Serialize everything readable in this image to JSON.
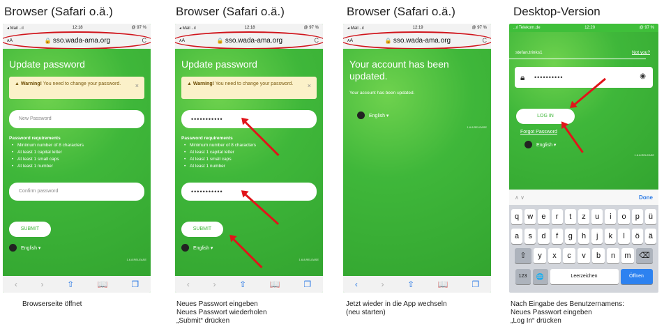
{
  "headings": [
    "Browser (Safari o.ä.)",
    "Browser (Safari o.ä.)",
    "Browser (Safari o.ä.)",
    "Desktop-Version"
  ],
  "status": {
    "carrier": "◂ Mail ..ıl ",
    "carrier4": "..ıl Telekom.de ",
    "time1": "12:18",
    "time2": "12:18",
    "time3": "12:19",
    "time4": "12:20",
    "battery": "@ 97 %"
  },
  "url": {
    "aa": "ᴀA",
    "address": "sso.wada-ama.org",
    "lock": "🔒",
    "reload": "C"
  },
  "screen1": {
    "title": "Update password",
    "warn_strong": "Warning!",
    "warn_text": " You need to change your password.",
    "warn_close": "×",
    "new_password_placeholder": "New Password",
    "req_title": "Password requirements",
    "req": [
      "Minimum number of 8 characters",
      "At least 1 capital letter",
      "At least 1 small caps",
      "At least 1 number"
    ],
    "confirm_placeholder": "Confirm password",
    "submit": "SUBMIT",
    "language": "English ▾",
    "release": "1.6.8.RELEASE"
  },
  "screen2": {
    "title": "Update password",
    "warn_strong": "Warning!",
    "warn_text": " You need to change your password.",
    "warn_close": "×",
    "new_password_value": "•••••••••••",
    "req_title": "Password requirements",
    "req": [
      "Minimum number of 8 characters",
      "At least 1 capital letter",
      "At least 1 small caps",
      "At least 1 number"
    ],
    "confirm_value": "•••••••••••",
    "submit": "SUBMIT",
    "language": "English ▾",
    "release": "1.6.8.RELEASE"
  },
  "screen3": {
    "title": "Your account has been updated.",
    "subtitle": "Your account has been updated.",
    "language": "English ▾",
    "release": "1.6.8.RELEASE"
  },
  "screen4": {
    "user": "stefan.trinks1",
    "not_you": "Not you?",
    "password_value": "••••••••••",
    "login": "LOG IN",
    "forgot": "Forgot Password",
    "language": "English ▾",
    "release": "1.6.8.RELEASE",
    "kbd_done": "Done",
    "kbd_nav": "∧   ∨",
    "row1": [
      "q",
      "w",
      "e",
      "r",
      "t",
      "z",
      "u",
      "i",
      "o",
      "p",
      "ü"
    ],
    "row2": [
      "a",
      "s",
      "d",
      "f",
      "g",
      "h",
      "j",
      "k",
      "l",
      "ö",
      "ä"
    ],
    "row3": [
      "y",
      "x",
      "c",
      "v",
      "b",
      "n",
      "m"
    ],
    "shift": "⇧",
    "backspace": "⌫",
    "num": "123",
    "globe": "🌐",
    "space": "Leerzeichen",
    "open": "Öffnen"
  },
  "toolbar": {
    "back": "‹",
    "forward": "›",
    "share": "⇧",
    "book": "📖",
    "tabs": "❐"
  },
  "captions": {
    "c1": "Browserseite öffnet",
    "c2": [
      "Neues Passwort eingeben",
      "Neues Passwort wiederholen",
      "„Submit“ drücken"
    ],
    "c3": [
      "Jetzt wieder in die App wechseln",
      "(neu starten)"
    ],
    "c4": [
      "Nach Eingabe des Benutzernamens:",
      "Neues Passwort eingeben",
      "„Log In“ drücken"
    ]
  }
}
